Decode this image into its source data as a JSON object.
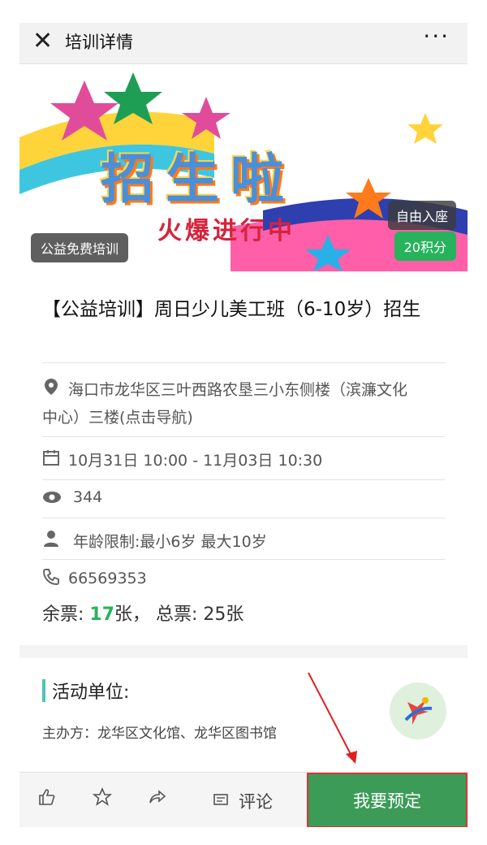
{
  "header": {
    "close_icon": "✕",
    "title": "培训详情",
    "more_icon": "···"
  },
  "banner": {
    "headline": "招生啦",
    "subline": "火爆进行中",
    "tag_free": "公益免费培训",
    "tag_seat": "自由入座",
    "tag_points": "20积分"
  },
  "event": {
    "title": "【公益培训】周日少儿美工班（6-10岁）招生",
    "address": "海口市龙华区三叶西路农垦三小东侧楼（滨濂文化中心）三楼(点击导航)",
    "datetime": "10月31日 10:00 - 11月03日 10:30",
    "views": "344",
    "age_limit": "年龄限制:最小6岁 最大10岁",
    "phone": "66569353",
    "tickets_label_remaining": "余票: ",
    "tickets_remaining": "17",
    "tickets_suffix": "张， 总票: 25张"
  },
  "organizer": {
    "label": "活动单位:",
    "host": "主办方：龙华区文化馆、龙华区图书馆"
  },
  "bottom_bar": {
    "comment_label": "评论",
    "reserve_label": "我要预定"
  },
  "colors": {
    "accent_green": "#27b35c",
    "reserve_button": "#3c9b57",
    "highlight_red": "#dd3333"
  }
}
